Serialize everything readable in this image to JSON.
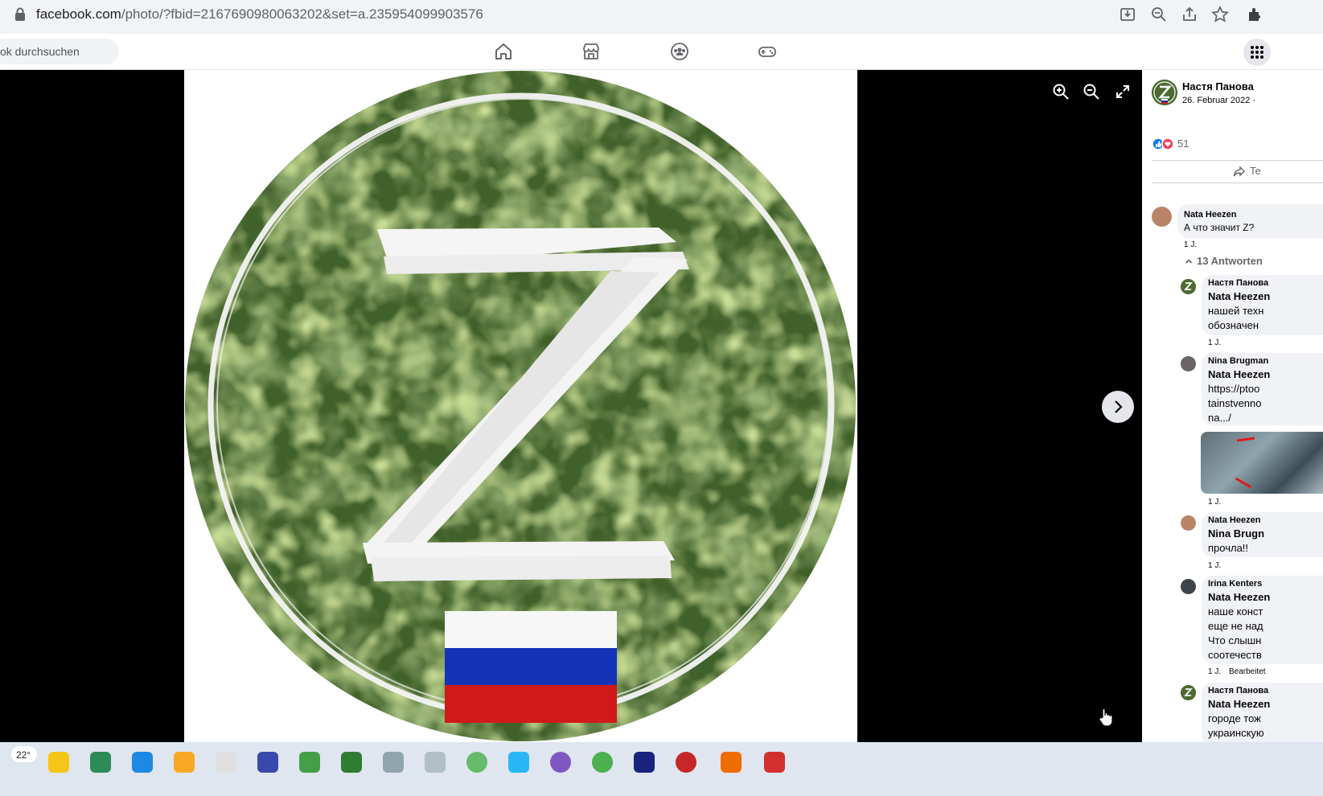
{
  "browser": {
    "url_domain": "facebook.com",
    "url_path": "/photo/?fbid=2167690980063202&set=a.235954099903576"
  },
  "fbnav": {
    "search_placeholder": "ok durchsuchen"
  },
  "post": {
    "author": "Настя Панова",
    "date": "26. Februar 2022 ·",
    "reaction_count": "51",
    "share_label": "Te"
  },
  "comments": {
    "top": {
      "author": "Nata Heezen",
      "text": "А что значит Z?",
      "time": "1 J."
    },
    "replies_toggle": "13 Antworten",
    "replies": [
      {
        "author": "Настя Панова",
        "lines": [
          "Nata Heezen",
          "нашей техн",
          "обозначен"
        ],
        "time": "1 J."
      },
      {
        "author": "Nina Brugman",
        "lines": [
          "Nata Heezen",
          "https://ptoo",
          "tainstvenno",
          "na.../"
        ],
        "time": "1 J."
      },
      {
        "author": "Nata Heezen",
        "lines": [
          "Nina Brugn",
          "прочла!!"
        ],
        "time": "1 J."
      },
      {
        "author": "Irina Kenters",
        "lines": [
          "Nata Heezen",
          "наше конст",
          "еще не над",
          "Что слышн",
          "соотечеств"
        ],
        "time": "1 J.",
        "extra": "Bearbeitet"
      },
      {
        "author": "Настя Панова",
        "lines": [
          "Nata Heezen",
          "городе тож",
          "украинскую"
        ]
      }
    ]
  },
  "photo": {
    "letter": "Z",
    "flag_colors": [
      "#ffffff",
      "#1433b8",
      "#d2191a"
    ]
  },
  "taskbar": {
    "temperature": "22°"
  },
  "colors": {
    "camo_base": "#55792f",
    "fb_blue": "#1877f2",
    "viewer_bg": "#000000"
  }
}
